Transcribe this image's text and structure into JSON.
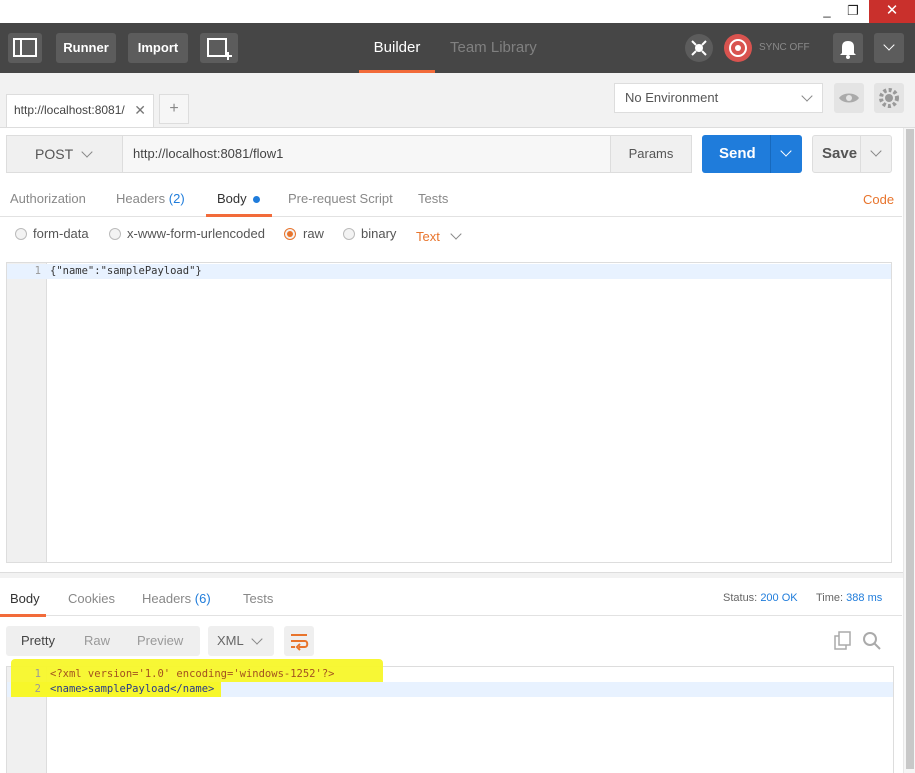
{
  "window": {
    "minimize": "_",
    "restore": "❐",
    "close": "✕"
  },
  "topbar": {
    "runner": "Runner",
    "import": "Import",
    "tabs": [
      {
        "label": "Builder",
        "active": true
      },
      {
        "label": "Team Library",
        "active": false
      }
    ],
    "sync_label": "SYNC OFF",
    "accent": "#f26b3a"
  },
  "tabstrip": {
    "request_tab": "http://localhost:8081/",
    "close": "✕",
    "new_tab": "+",
    "environment": "No Environment"
  },
  "request": {
    "method": "POST",
    "url": "http://localhost:8081/flow1",
    "params": "Params",
    "send": "Send",
    "save": "Save",
    "send_color": "#1f7cdb"
  },
  "request_tabs": {
    "authorization": "Authorization",
    "headers": "Headers",
    "headers_count": "(2)",
    "body": "Body",
    "prerequest": "Pre-request Script",
    "tests": "Tests",
    "code": "Code"
  },
  "body_modes": {
    "form_data": "form-data",
    "urlencoded": "x-www-form-urlencoded",
    "raw": "raw",
    "binary": "binary",
    "selected": "raw",
    "text_type": "Text"
  },
  "request_body": {
    "lines": [
      {
        "num": "1",
        "text": "{\"name\":\"samplePayload\"}"
      }
    ]
  },
  "response": {
    "tabs": {
      "body": "Body",
      "cookies": "Cookies",
      "headers": "Headers",
      "headers_count": "(6)",
      "tests": "Tests"
    },
    "status_label": "Status:",
    "status_value": "200 OK",
    "time_label": "Time:",
    "time_value": "388 ms",
    "formats": {
      "pretty": "Pretty",
      "raw": "Raw",
      "preview": "Preview"
    },
    "language": "XML",
    "lines": [
      {
        "num": "1",
        "text": "<?xml version='1.0' encoding='windows-1252'?>"
      },
      {
        "num": "2",
        "text": "<name>samplePayload</name>"
      }
    ],
    "highlight_color": "#f7f72a"
  }
}
